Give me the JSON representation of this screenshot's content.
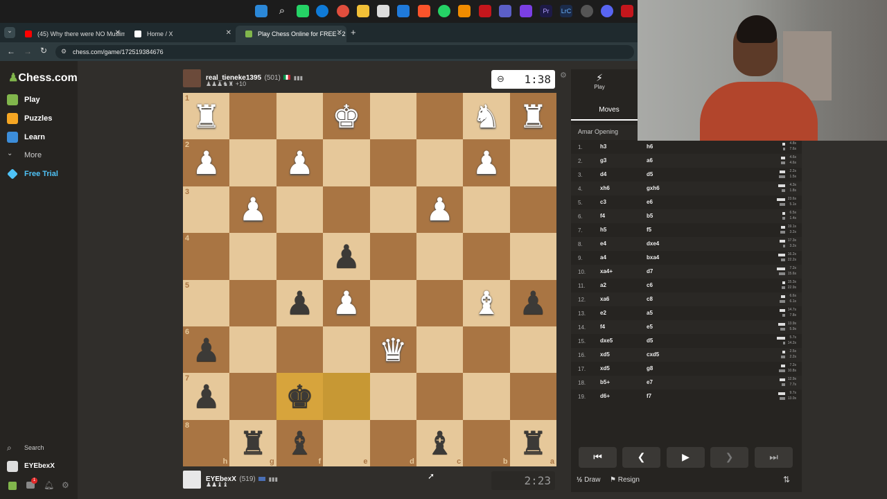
{
  "browser": {
    "tabs": [
      {
        "label": "(45) Why there were NO Muslim",
        "favicon_color": "#ff0000"
      },
      {
        "label": "Home / X",
        "favicon_color": "#ffffff"
      },
      {
        "label": "Play Chess Online for FREE - 2 P",
        "favicon_color": "#81b64c"
      }
    ],
    "url": "chess.com/game/172519384676"
  },
  "sidebar": {
    "logo": "Chess.com",
    "items": [
      {
        "label": "Play",
        "color": "#81b64c"
      },
      {
        "label": "Puzzles",
        "color": "#f5a623"
      },
      {
        "label": "Learn",
        "color": "#3c8dd9"
      },
      {
        "label": "More",
        "color": "#888888"
      },
      {
        "label": "Free Trial",
        "color": "#4fc3f7"
      }
    ],
    "search_label": "Search",
    "username": "EYEbexX",
    "mail_badge": "1"
  },
  "top_player": {
    "name": "real_tieneke1395",
    "rating": "(501)",
    "captured_extra": "+10",
    "clock": "1:38"
  },
  "bottom_player": {
    "name": "EYEbexX",
    "rating": "(519)",
    "clock": "2:23"
  },
  "board": {
    "ranks": [
      "1",
      "2",
      "3",
      "4",
      "5",
      "6",
      "7",
      "8"
    ],
    "files": [
      "h",
      "g",
      "f",
      "e",
      "d",
      "c",
      "b",
      "a"
    ],
    "squares": [
      [
        "wR",
        "",
        "",
        "wK",
        "",
        "",
        "wN",
        "wR"
      ],
      [
        "wP",
        "",
        "wP",
        "",
        "",
        "",
        "wP",
        ""
      ],
      [
        "",
        "wP",
        "",
        "",
        "",
        "wP",
        "",
        ""
      ],
      [
        "",
        "",
        "",
        "bP",
        "",
        "",
        "",
        ""
      ],
      [
        "",
        "",
        "bP",
        "wP",
        "",
        "",
        "wB",
        "bP"
      ],
      [
        "bP",
        "",
        "",
        "",
        "wQ",
        "",
        "",
        ""
      ],
      [
        "bP",
        "",
        "bK",
        "",
        "",
        "",
        "",
        ""
      ],
      [
        "",
        "bR",
        "bB",
        "",
        "",
        "bB",
        "",
        "bR"
      ]
    ]
  },
  "panel": {
    "play_label": "Play",
    "moves_tab": "Moves",
    "opening": "Amar Opening",
    "moves": [
      {
        "n": "1.",
        "w": "h3",
        "b": "h6",
        "wt": "4.8s",
        "bt": "7.6s"
      },
      {
        "n": "2.",
        "w": "g3",
        "b": "a6",
        "wt": "4.6s",
        "bt": "4.6s"
      },
      {
        "n": "3.",
        "w": "d4",
        "b": "d5",
        "wt": "2.2s",
        "bt": "1.5s"
      },
      {
        "n": "4.",
        "w": "xh6",
        "b": "gxh6",
        "wt": "4.3s",
        "bt": "1.8s"
      },
      {
        "n": "5.",
        "w": "c3",
        "b": "e6",
        "wt": "23.6s",
        "bt": "5.1s"
      },
      {
        "n": "6.",
        "w": "f4",
        "b": "b5",
        "wt": "6.5s",
        "bt": "1.4s"
      },
      {
        "n": "7.",
        "w": "h5",
        "b": "f5",
        "wt": "19.1s",
        "bt": "3.2s"
      },
      {
        "n": "8.",
        "w": "e4",
        "b": "dxe4",
        "wt": "17.3s",
        "bt": "3.2s"
      },
      {
        "n": "9.",
        "w": "a4",
        "b": "bxa4",
        "wt": "16.2s",
        "bt": "22.2s"
      },
      {
        "n": "10.",
        "w": "xa4+",
        "b": "d7",
        "wt": "7.2s",
        "bt": "15.6s"
      },
      {
        "n": "11.",
        "w": "a2",
        "b": "c6",
        "wt": "15.3s",
        "bt": "22.9s"
      },
      {
        "n": "12.",
        "w": "xa6",
        "b": "c8",
        "wt": "6.6s",
        "bt": "6.1s"
      },
      {
        "n": "13.",
        "w": "e2",
        "b": "a5",
        "wt": "14.7s",
        "bt": "7.8s"
      },
      {
        "n": "14.",
        "w": "f4",
        "b": "e5",
        "wt": "13.9s",
        "bt": "5.9s"
      },
      {
        "n": "15.",
        "w": "dxe5",
        "b": "d5",
        "wt": "5.7s",
        "bt": "14.2s"
      },
      {
        "n": "16.",
        "w": "xd5",
        "b": "cxd5",
        "wt": "2.5s",
        "bt": "2.2s"
      },
      {
        "n": "17.",
        "w": "xd5",
        "b": "g8",
        "wt": "7.2s",
        "bt": "10.8s"
      },
      {
        "n": "18.",
        "w": "b5+",
        "b": "e7",
        "wt": "12.9s",
        "bt": "7.7s"
      },
      {
        "n": "19.",
        "w": "d6+",
        "b": "f7",
        "wt": "9.7s",
        "bt": "13.0s"
      }
    ],
    "draw_label": "Draw",
    "draw_prefix": "½",
    "resign_label": "Resign"
  }
}
